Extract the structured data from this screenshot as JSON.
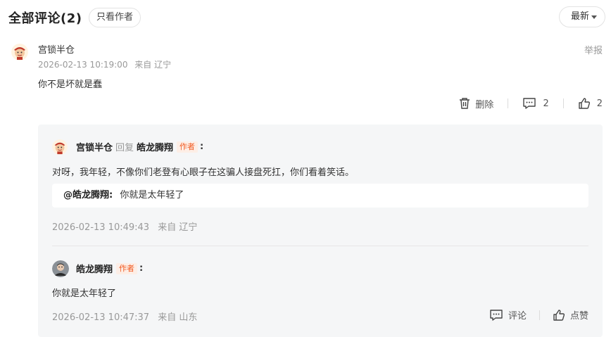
{
  "header": {
    "title": "全部评论(2)",
    "author_only": "只看作者",
    "sort": "最新"
  },
  "comment": {
    "user": "宫锁半仓",
    "time": "2026-02-13 10:19:00",
    "location": "来自 辽宁",
    "report": "举报",
    "text": "你不是坏就是蠢",
    "actions": {
      "delete": "删除",
      "reply_count": "2",
      "like_count": "2"
    }
  },
  "replies": [
    {
      "user": "宫锁半仓",
      "reply_word": "回复",
      "target": "皓龙腾翔",
      "author_tag": "作者",
      "text": "对呀，我年轻，不像你们老登有心眼子在这骗人接盘死扛，你们看着笑话。",
      "quote_name": "@皓龙腾翔:",
      "quote_text": "你就是太年轻了",
      "time": "2026-02-13 10:49:43",
      "location": "来自 辽宁"
    },
    {
      "user": "皓龙腾翔",
      "author_tag": "作者",
      "text": "你就是太年轻了",
      "time": "2026-02-13 10:47:37",
      "location": "来自 山东",
      "comment_label": "评论",
      "like_label": "点赞"
    }
  ],
  "colors": {
    "author_tag": "#f15a22",
    "muted": "#999999",
    "reply_bg": "#f5f6f7"
  }
}
